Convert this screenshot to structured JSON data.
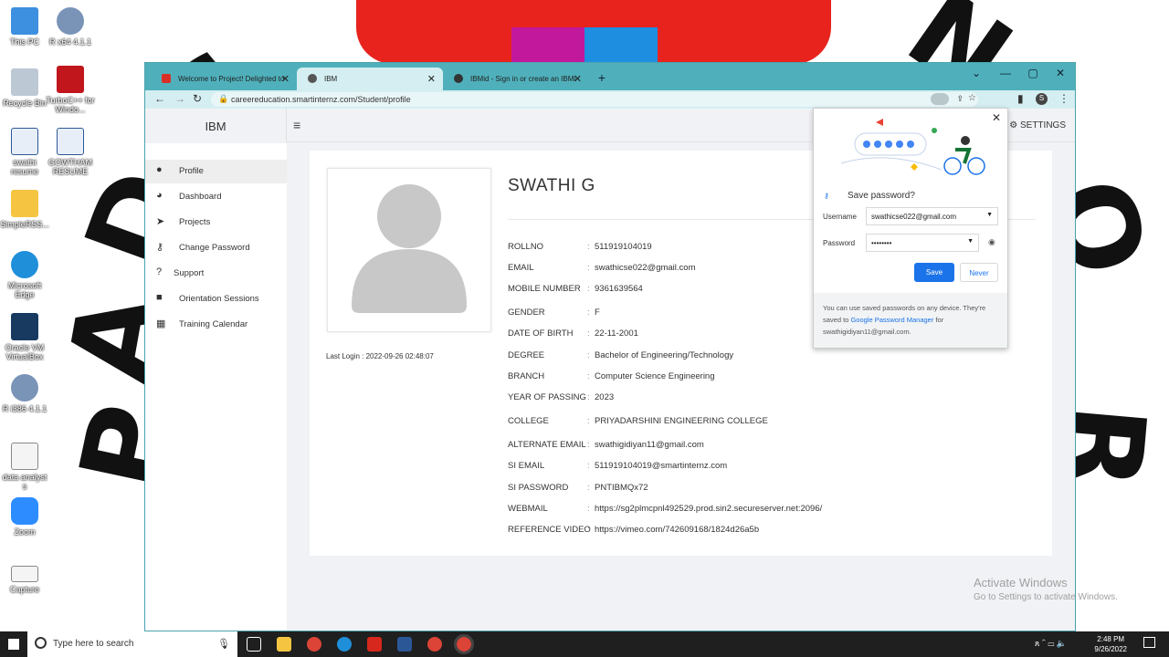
{
  "desktop": {
    "icons": [
      {
        "label": "This PC"
      },
      {
        "label": "R x64 4.1.1"
      },
      {
        "label": "Recycle Bin"
      },
      {
        "label": "TurboC++ for Windo..."
      },
      {
        "label": "swathi resume"
      },
      {
        "label": "GOWTHAM RESUME"
      },
      {
        "label": "SimpleRSS..."
      },
      {
        "label": "Microsoft Edge"
      },
      {
        "label": "Oracle VM VirtualBox"
      },
      {
        "label": "R i386 4.1.1"
      },
      {
        "label": "data analyst s"
      },
      {
        "label": "Zoom"
      },
      {
        "label": "Capture"
      }
    ]
  },
  "browser": {
    "tabs": [
      {
        "title": "Welcome to Project! Delighted to",
        "icon": "gmail-icon"
      },
      {
        "title": "IBM",
        "icon": "globe-icon"
      },
      {
        "title": "IBMid - Sign in or create an IBMi",
        "icon": "ibm-icon"
      }
    ],
    "url": "careereducation.smartinternz.com/Student/profile",
    "profile_initial": "S"
  },
  "app": {
    "brand": "IBM",
    "settings_label": "SETTINGS",
    "sidebar": [
      {
        "label": "Profile",
        "icon": "user-icon"
      },
      {
        "label": "Dashboard",
        "icon": "dashboard-icon"
      },
      {
        "label": "Projects",
        "icon": "paper-plane-icon"
      },
      {
        "label": "Change Password",
        "icon": "key-icon"
      },
      {
        "label": "Support",
        "icon": "question-icon"
      },
      {
        "label": "Orientation Sessions",
        "icon": "video-icon"
      },
      {
        "label": "Training Calendar",
        "icon": "calendar-icon"
      }
    ]
  },
  "profile": {
    "name": "SWATHI G",
    "last_login": "Last Login : 2022-09-26 02:48:07",
    "fields": [
      {
        "label": "ROLLNO",
        "value": "511919104019"
      },
      {
        "label": "EMAIL",
        "value": "swathicse022@gmail.com"
      },
      {
        "label": "MOBILE NUMBER",
        "value": "9361639564"
      },
      {
        "label": "GENDER",
        "value": "F"
      },
      {
        "label": "DATE OF BIRTH",
        "value": "22-11-2001"
      },
      {
        "label": "DEGREE",
        "value": "Bachelor of Engineering/Technology"
      },
      {
        "label": "BRANCH",
        "value": "Computer Science Engineering"
      },
      {
        "label": "YEAR OF PASSING",
        "value": "2023"
      },
      {
        "label": "COLLEGE",
        "value": "PRIYADARSHINI ENGINEERING COLLEGE"
      },
      {
        "label": "ALTERNATE EMAIL",
        "value": "swathigidiyan11@gmail.com"
      },
      {
        "label": "SI EMAIL",
        "value": "511919104019@smartinternz.com"
      },
      {
        "label": "SI PASSWORD",
        "value": "PNTIBMQx72"
      },
      {
        "label": "WEBMAIL",
        "value": "https://sg2plmcpnl492529.prod.sin2.secureserver.net:2096/"
      },
      {
        "label": "REFERENCE VIDEO",
        "value": "https://vimeo.com/742609168/1824d26a5b"
      }
    ]
  },
  "password_popup": {
    "title": "Save password?",
    "username_label": "Username",
    "username_value": "swathicse022@gmail.com",
    "password_label": "Password",
    "password_value": "••••••••",
    "save_label": "Save",
    "never_label": "Never",
    "footer_text_1": "You can use saved passwords on any device. They're saved to",
    "footer_link": "Google Password Manager",
    "footer_text_2": "for swathigidiyan11@gmail.com."
  },
  "watermark": {
    "line1": "Activate Windows",
    "line2": "Go to Settings to activate Windows."
  },
  "taskbar": {
    "search_placeholder": "Type here to search",
    "time": "2:48 PM",
    "date": "9/26/2022"
  }
}
